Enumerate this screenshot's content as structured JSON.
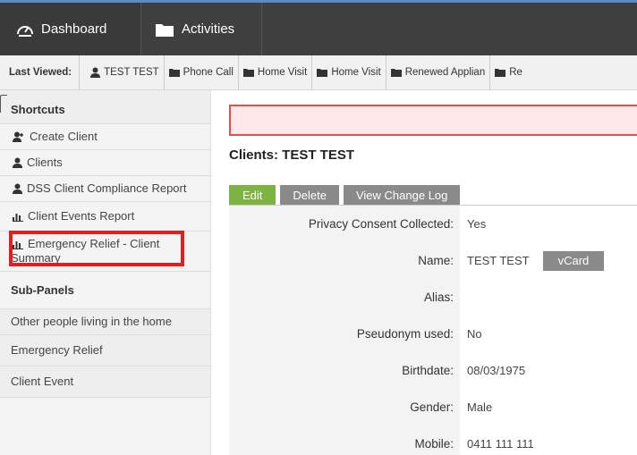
{
  "topnav": {
    "tabs": [
      {
        "label": "Dashboard",
        "icon": "gauge-icon"
      },
      {
        "label": "Activities",
        "icon": "folder-icon"
      }
    ],
    "accent": "#5b8ac7"
  },
  "last_viewed": {
    "label": "Last Viewed:",
    "items": [
      {
        "label": "TEST TEST",
        "icon": "person-icon"
      },
      {
        "label": "Phone Call",
        "icon": "folder-icon"
      },
      {
        "label": "Home Visit",
        "icon": "folder-icon"
      },
      {
        "label": "Home Visit",
        "icon": "folder-icon"
      },
      {
        "label": "Renewed Applian",
        "icon": "folder-icon"
      },
      {
        "label": "Re",
        "icon": "folder-icon"
      }
    ]
  },
  "sidebar": {
    "shortcuts_heading": "Shortcuts",
    "shortcuts": [
      {
        "label": "Create Client",
        "icon": "add-person-icon"
      },
      {
        "label": "Clients",
        "icon": "person-icon"
      },
      {
        "label": "DSS Client Compliance Report",
        "icon": "person-icon"
      },
      {
        "label": "Client Events Report",
        "icon": "bar-chart-icon"
      },
      {
        "label": "Emergency Relief - Client Summary",
        "icon": "bar-chart-icon"
      }
    ],
    "subpanels_heading": "Sub-Panels",
    "subpanels": [
      {
        "label": "Other people living in the home"
      },
      {
        "label": "Emergency Relief"
      },
      {
        "label": "Client Event"
      }
    ],
    "highlight_color": "#e02020"
  },
  "main": {
    "title": "Clients: TEST TEST",
    "buttons": {
      "edit": "Edit",
      "delete": "Delete",
      "view_change_log": "View Change Log",
      "vcard": "vCard"
    },
    "fields": [
      {
        "label": "Privacy Consent Collected:",
        "value": "Yes"
      },
      {
        "label": "Name:",
        "value": "TEST TEST"
      },
      {
        "label": "Alias:",
        "value": ""
      },
      {
        "label": "Pseudonym used:",
        "value": "No"
      },
      {
        "label": "Birthdate:",
        "value": "08/03/1975"
      },
      {
        "label": "Gender:",
        "value": "Male"
      },
      {
        "label": "Mobile:",
        "value": "0411 111 111"
      }
    ],
    "edit_color": "#7cb342",
    "alert_border": "#e05050"
  }
}
